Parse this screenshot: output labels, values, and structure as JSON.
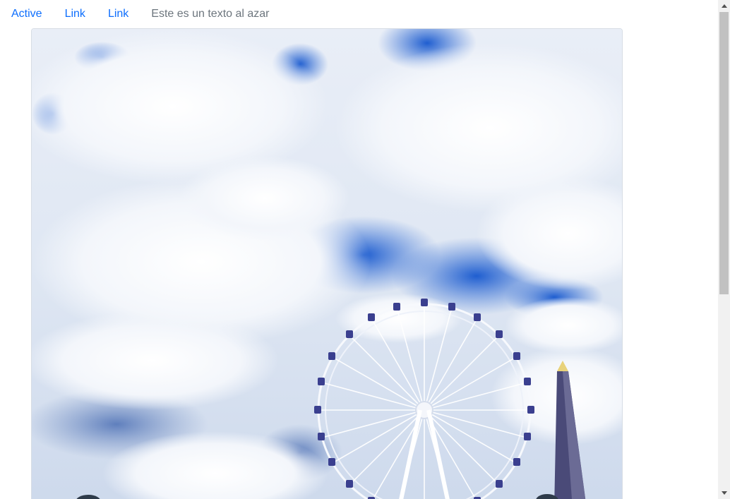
{
  "nav": {
    "items": [
      {
        "label": "Active",
        "active": true
      },
      {
        "label": "Link"
      },
      {
        "label": "Link"
      }
    ],
    "text": "Este es un texto al azar"
  },
  "colors": {
    "link": "#0d6efd",
    "muted_text": "#6c757d",
    "sky_blue": "#2f63c9",
    "wheel": "#3a3f8f"
  },
  "image": {
    "icon": "photo-ferris-wheel-sky"
  }
}
